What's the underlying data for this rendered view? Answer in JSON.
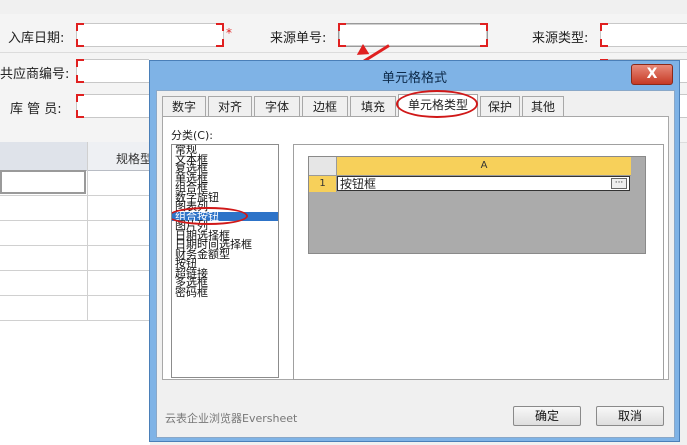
{
  "form": {
    "row1": {
      "label_in_date": "入库日期:",
      "label_source_no": "来源单号:",
      "label_source_type": "来源类型:",
      "required_mark": "*"
    },
    "row2": {
      "label_supplier_no": "共应商编号:"
    },
    "row3": {
      "label_keeper": "库 管 员:"
    },
    "grid": {
      "header_spec": "规格型"
    }
  },
  "dialog": {
    "title": "单元格格式",
    "close_label": "X",
    "tabs": [
      {
        "label": "数字"
      },
      {
        "label": "对齐"
      },
      {
        "label": "字体"
      },
      {
        "label": "边框"
      },
      {
        "label": "填充"
      },
      {
        "label": "单元格类型"
      },
      {
        "label": "保护"
      },
      {
        "label": "其他"
      }
    ],
    "active_tab": "单元格类型",
    "category_label": "分类(C):",
    "categories": [
      {
        "label": "常规"
      },
      {
        "label": "文本框"
      },
      {
        "label": "复选框"
      },
      {
        "label": "单选框"
      },
      {
        "label": "组合框"
      },
      {
        "label": "数字旋钮"
      },
      {
        "label": "图表列"
      },
      {
        "label": "组合按钮"
      },
      {
        "label": "图片列"
      },
      {
        "label": "日期选择框"
      },
      {
        "label": "日期时间选择框"
      },
      {
        "label": "财务金额型"
      },
      {
        "label": "按钮"
      },
      {
        "label": "超链接"
      },
      {
        "label": "多选框"
      },
      {
        "label": "密码框"
      }
    ],
    "selected_category": "组合按钮",
    "preview": {
      "column_header": "A",
      "row_header": "1",
      "cell_value": "按钮框",
      "ellipsis": "···"
    },
    "brand": "云表企业浏览器Eversheet",
    "ok_label": "确定",
    "cancel_label": "取消"
  }
}
